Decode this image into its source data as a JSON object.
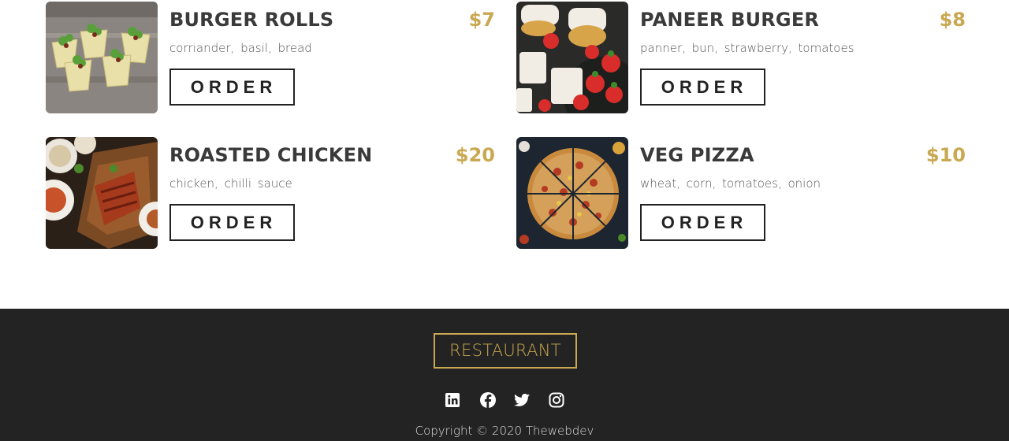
{
  "menu": {
    "items": [
      {
        "name": "BURGER ROLLS",
        "price": "$7",
        "description": "corriander, basil, bread",
        "order_label": "ORDER"
      },
      {
        "name": "PANEER BURGER",
        "price": "$8",
        "description": "panner, bun, strawberry, tomatoes",
        "order_label": "ORDER"
      },
      {
        "name": "ROASTED CHICKEN",
        "price": "$20",
        "description": "chicken, chilli sauce",
        "order_label": "ORDER"
      },
      {
        "name": "VEG PIZZA",
        "price": "$10",
        "description": "wheat, corn, tomatoes, onion",
        "order_label": "ORDER"
      }
    ]
  },
  "footer": {
    "brand": "RESTAURANT",
    "socials": [
      "linkedin-icon",
      "facebook-icon",
      "twitter-icon",
      "instagram-icon"
    ],
    "copyright": "Copyright © 2020 Thewebdev"
  },
  "colors": {
    "accent": "#c9a851",
    "footer_bg": "#232323",
    "text_dark": "#3a3a3a"
  }
}
